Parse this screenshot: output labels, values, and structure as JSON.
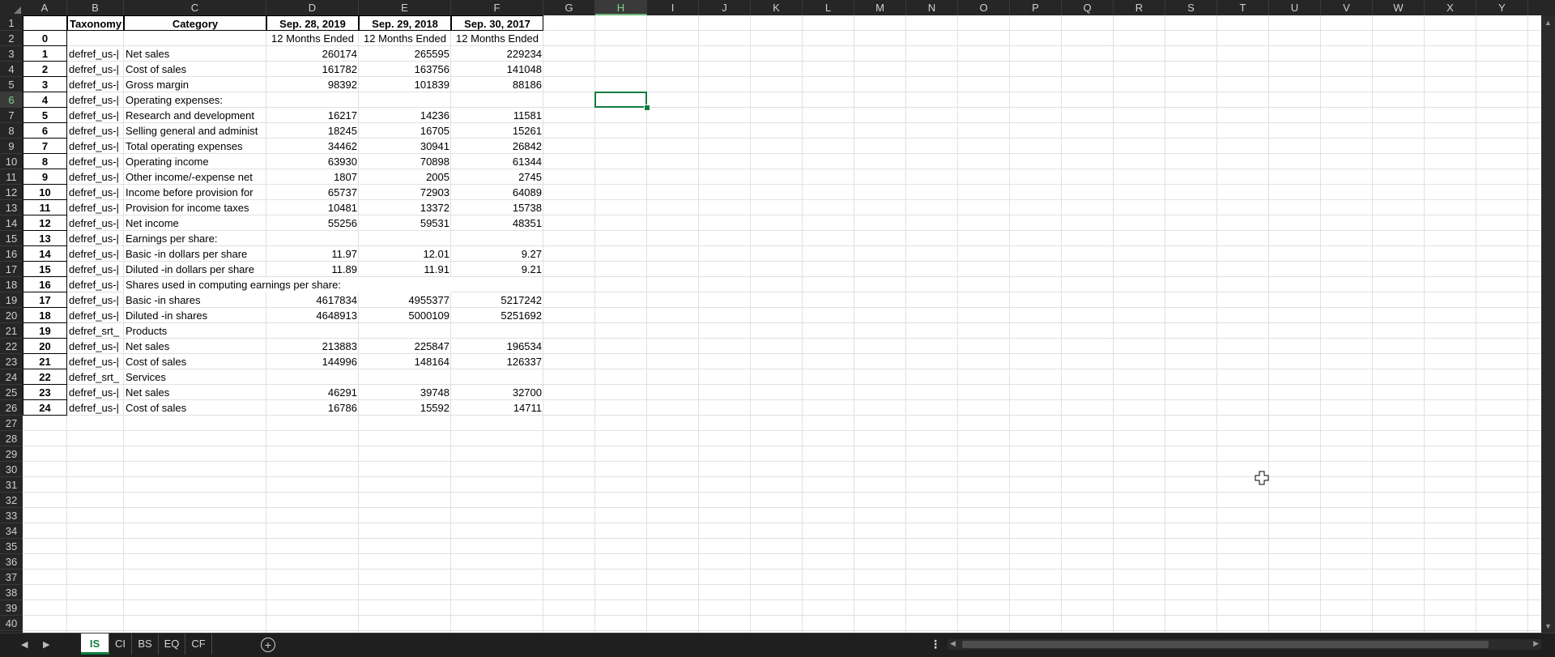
{
  "columns": [
    "A",
    "B",
    "C",
    "D",
    "E",
    "F",
    "G",
    "H",
    "I",
    "J",
    "K",
    "L",
    "M",
    "N",
    "O",
    "P",
    "Q",
    "R",
    "S",
    "T",
    "U",
    "V",
    "W",
    "X",
    "Y"
  ],
  "selected_cell": "H6",
  "header_row": {
    "b": "Taxonomy",
    "c": "Category",
    "d": "Sep. 28, 2019",
    "e": "Sep. 29, 2018",
    "f": "Sep. 30, 2017"
  },
  "period_row": {
    "a": "0",
    "d": "12 Months Ended",
    "e": "12 Months Ended",
    "f": "12 Months Ended"
  },
  "rows": [
    {
      "a": "1",
      "b": "defref_us-|",
      "c": "Net sales",
      "d": "260174",
      "e": "265595",
      "f": "229234"
    },
    {
      "a": "2",
      "b": "defref_us-|",
      "c": "Cost of sales",
      "d": "161782",
      "e": "163756",
      "f": "141048"
    },
    {
      "a": "3",
      "b": "defref_us-|",
      "c": "Gross margin",
      "d": "98392",
      "e": "101839",
      "f": "88186"
    },
    {
      "a": "4",
      "b": "defref_us-|",
      "c": "Operating expenses:",
      "d": "",
      "e": "",
      "f": ""
    },
    {
      "a": "5",
      "b": "defref_us-|",
      "c": "Research and development",
      "d": "16217",
      "e": "14236",
      "f": "11581"
    },
    {
      "a": "6",
      "b": "defref_us-|",
      "c": "Selling general and administ",
      "d": "18245",
      "e": "16705",
      "f": "15261"
    },
    {
      "a": "7",
      "b": "defref_us-|",
      "c": "Total operating expenses",
      "d": "34462",
      "e": "30941",
      "f": "26842"
    },
    {
      "a": "8",
      "b": "defref_us-|",
      "c": "Operating income",
      "d": "63930",
      "e": "70898",
      "f": "61344"
    },
    {
      "a": "9",
      "b": "defref_us-|",
      "c": "Other income/-expense net",
      "d": "1807",
      "e": "2005",
      "f": "2745"
    },
    {
      "a": "10",
      "b": "defref_us-|",
      "c": "Income before provision for",
      "d": "65737",
      "e": "72903",
      "f": "64089"
    },
    {
      "a": "11",
      "b": "defref_us-|",
      "c": "Provision for income taxes",
      "d": "10481",
      "e": "13372",
      "f": "15738"
    },
    {
      "a": "12",
      "b": "defref_us-|",
      "c": "Net income",
      "d": "55256",
      "e": "59531",
      "f": "48351"
    },
    {
      "a": "13",
      "b": "defref_us-|",
      "c": "Earnings per share:",
      "d": "",
      "e": "",
      "f": ""
    },
    {
      "a": "14",
      "b": "defref_us-|",
      "c": "Basic -in dollars per share",
      "d": "11.97",
      "e": "12.01",
      "f": "9.27"
    },
    {
      "a": "15",
      "b": "defref_us-|",
      "c": "Diluted -in dollars per share",
      "d": "11.89",
      "e": "11.91",
      "f": "9.21"
    },
    {
      "a": "16",
      "b": "defref_us-|",
      "c": "Shares used in computing earnings per share:",
      "d": "",
      "e": "",
      "f": "",
      "spill": true
    },
    {
      "a": "17",
      "b": "defref_us-|",
      "c": "Basic -in shares",
      "d": "4617834",
      "e": "4955377",
      "f": "5217242"
    },
    {
      "a": "18",
      "b": "defref_us-|",
      "c": "Diluted -in shares",
      "d": "4648913",
      "e": "5000109",
      "f": "5251692"
    },
    {
      "a": "19",
      "b": "defref_srt_",
      "c": "Products",
      "d": "",
      "e": "",
      "f": ""
    },
    {
      "a": "20",
      "b": "defref_us-|",
      "c": "Net sales",
      "d": "213883",
      "e": "225847",
      "f": "196534"
    },
    {
      "a": "21",
      "b": "defref_us-|",
      "c": "Cost of sales",
      "d": "144996",
      "e": "148164",
      "f": "126337"
    },
    {
      "a": "22",
      "b": "defref_srt_",
      "c": "Services",
      "d": "",
      "e": "",
      "f": ""
    },
    {
      "a": "23",
      "b": "defref_us-|",
      "c": "Net sales",
      "d": "46291",
      "e": "39748",
      "f": "32700"
    },
    {
      "a": "24",
      "b": "defref_us-|",
      "c": "Cost of sales",
      "d": "16786",
      "e": "15592",
      "f": "14711"
    }
  ],
  "row_numbers": [
    "1",
    "2",
    "3",
    "4",
    "5",
    "6",
    "7",
    "8",
    "9",
    "10",
    "11",
    "12",
    "13",
    "14",
    "15",
    "16",
    "17",
    "18",
    "19",
    "20",
    "21",
    "22",
    "23",
    "24",
    "25",
    "26",
    "27",
    "28",
    "29",
    "30",
    "31",
    "32",
    "33",
    "34",
    "35",
    "36",
    "37",
    "38",
    "39",
    "40"
  ],
  "sheet_tabs": [
    {
      "label": "IS",
      "active": true
    },
    {
      "label": "CI",
      "active": false
    },
    {
      "label": "BS",
      "active": false
    },
    {
      "label": "EQ",
      "active": false
    },
    {
      "label": "CF",
      "active": false
    }
  ],
  "icons": {
    "prev_sheet": "chevron-left-icon",
    "next_sheet": "chevron-right-icon",
    "add_sheet": "plus-circle-icon",
    "more_options": "vertical-ellipsis-icon",
    "cursor": "cross-cursor-icon"
  },
  "colors": {
    "accent": "#107c41",
    "background": "#1f1f1f",
    "grid_line": "#e1e1e1"
  }
}
